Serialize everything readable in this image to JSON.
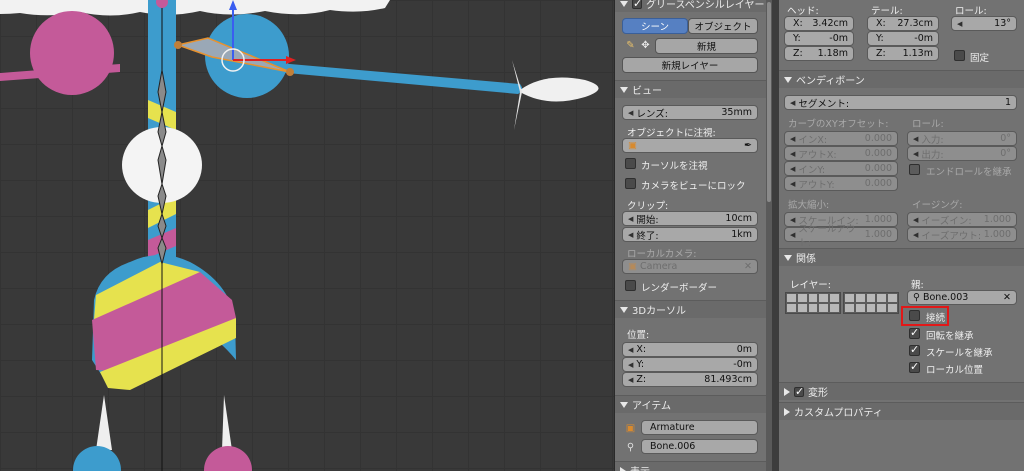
{
  "viewport": {
    "label": "3D Viewport"
  },
  "npanel": {
    "grease_pencil": {
      "title": "グリースペンシルレイヤー",
      "tab_scene": "シーン",
      "tab_object": "オブジェクト",
      "new_label": "新規",
      "new_layer_label": "新規レイヤー"
    },
    "view": {
      "title": "ビュー",
      "lens_label": "レンズ:",
      "lens_value": "35mm",
      "lock_object_label": "オブジェクトに注視:",
      "lock_cursor_label": "カーソルを注視",
      "lock_camera_label": "カメラをビューにロック",
      "clip_label": "クリップ:",
      "clip_start_label": "開始:",
      "clip_start_value": "10cm",
      "clip_end_label": "終了:",
      "clip_end_value": "1km",
      "local_camera_label": "ローカルカメラ:",
      "local_camera_value": "Camera",
      "render_border_label": "レンダーボーダー"
    },
    "cursor": {
      "title": "3Dカーソル",
      "location_label": "位置:",
      "x_label": "X:",
      "x_value": "0m",
      "y_label": "Y:",
      "y_value": "-0m",
      "z_label": "Z:",
      "z_value": "81.493cm"
    },
    "item": {
      "title": "アイテム",
      "object_name": "Armature",
      "bone_name": "Bone.006"
    },
    "next_section": "表示"
  },
  "props": {
    "head": {
      "label": "ヘッド:",
      "x": "3.42cm",
      "y": "-0m",
      "z": "1.18m"
    },
    "tail": {
      "label": "テール:",
      "x": "27.3cm",
      "y": "-0m",
      "z": "1.13m"
    },
    "roll": {
      "label": "ロール:",
      "value": "13°"
    },
    "lock_label": "固定",
    "axis": {
      "x": "X:",
      "y": "Y:",
      "z": "Z:"
    },
    "bendy": {
      "title": "ベンディボーン",
      "segments_label": "セグメント:",
      "segments_value": "1",
      "curve_offset_label": "カーブのXYオフセット:",
      "roll_label": "ロール:",
      "in_x_label": "インX:",
      "in_x_value": "0.000",
      "out_x_label": "アウトX:",
      "out_x_value": "0.000",
      "in_y_label": "インY:",
      "in_y_value": "0.000",
      "out_y_label": "アウトY:",
      "out_y_value": "0.000",
      "in_label": "入力:",
      "in_value": "0°",
      "out_label": "出力:",
      "out_value": "0°",
      "inherit_end_roll_label": "エンドロールを継承",
      "scale_label": "拡大縮小:",
      "ease_label": "イージング:",
      "scale_in_label": "スケールイン:",
      "scale_in_value": "1.000",
      "scale_out_label": "スケールアウト:",
      "scale_out_value": "1.000",
      "ease_in_label": "イーズイン:",
      "ease_in_value": "1.000",
      "ease_out_label": "イーズアウト:",
      "ease_out_value": "1.000"
    },
    "relations": {
      "title": "関係",
      "layers_label": "レイヤー:",
      "parent_label": "親:",
      "parent_value": "Bone.003",
      "connected_label": "接続",
      "inherit_rotation_label": "回転を継承",
      "inherit_scale_label": "スケールを継承",
      "local_location_label": "ローカル位置"
    },
    "deform_title": "変形",
    "custom_props_title": "カスタムプロパティ"
  },
  "colors": {
    "selection_blue": "#5680c2",
    "highlight_red": "#e21818",
    "model_blue": "#3b9fcf",
    "model_pink": "#c8569c",
    "model_yellow": "#e6e24e"
  }
}
